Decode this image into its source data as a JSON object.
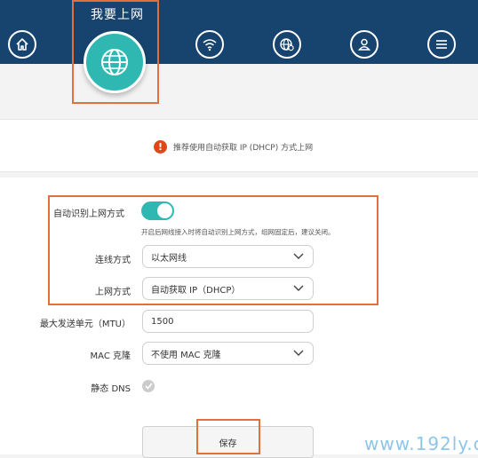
{
  "nav": {
    "active_title": "我要上网",
    "icons": [
      "home-icon",
      "globe-icon",
      "wifi-icon",
      "globe-settings-icon",
      "user-icon",
      "menu-icon"
    ]
  },
  "notice": {
    "icon": "exclamation-icon",
    "text": "推荐使用自动获取 IP (DHCP) 方式上网"
  },
  "form": {
    "auto_detect_label": "自动识别上网方式",
    "auto_detect_on": true,
    "auto_detect_hint": "开启后网线接入时将自动识别上网方式，组网固定后，建议关闭。",
    "connection_label": "连线方式",
    "connection_value": "以太网线",
    "internet_label": "上网方式",
    "internet_value": "自动获取 IP（DHCP）",
    "mtu_label": "最大发送单元（MTU）",
    "mtu_value": "1500",
    "mac_label": "MAC 克隆",
    "mac_value": "不使用 MAC 克隆",
    "dns_label": "静态 DNS",
    "save_label": "保存"
  },
  "colors": {
    "nav_bg": "#17446f",
    "accent": "#2fb8b2",
    "highlight": "#e2703f",
    "warning": "#e0471a"
  },
  "watermark": "www.192ly.cc"
}
